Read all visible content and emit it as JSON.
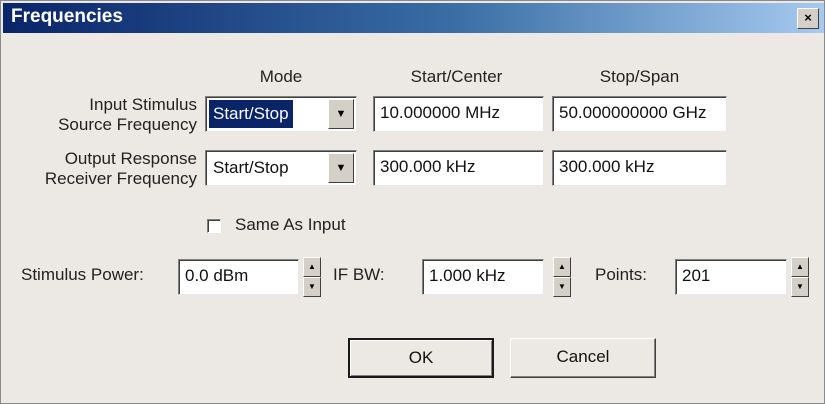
{
  "dialog": {
    "title": "Frequencies",
    "close_glyph": "×"
  },
  "headers": {
    "mode": "Mode",
    "start_center": "Start/Center",
    "stop_span": "Stop/Span"
  },
  "input_stimulus": {
    "label_line1": "Input Stimulus",
    "label_line2": "Source Frequency",
    "mode_value": "Start/Stop",
    "start_value": "10.000000 MHz",
    "stop_value": "50.000000000 GHz"
  },
  "output_response": {
    "label_line1": "Output Response",
    "label_line2": "Receiver Frequency",
    "mode_value": "Start/Stop",
    "start_value": "300.000 kHz",
    "stop_value": "300.000 kHz"
  },
  "same_as_input": {
    "label": "Same As Input",
    "checked": false
  },
  "stimulus_power": {
    "label": "Stimulus Power:",
    "value": "0.0 dBm"
  },
  "if_bw": {
    "label": "IF BW:",
    "value": "1.000 kHz"
  },
  "points": {
    "label": "Points:",
    "value": "201"
  },
  "buttons": {
    "ok": "OK",
    "cancel": "Cancel"
  },
  "icons": {
    "dropdown": "chevron-down-icon",
    "spin_up": "arrow-up-icon",
    "spin_down": "arrow-down-icon",
    "close": "close-icon"
  }
}
